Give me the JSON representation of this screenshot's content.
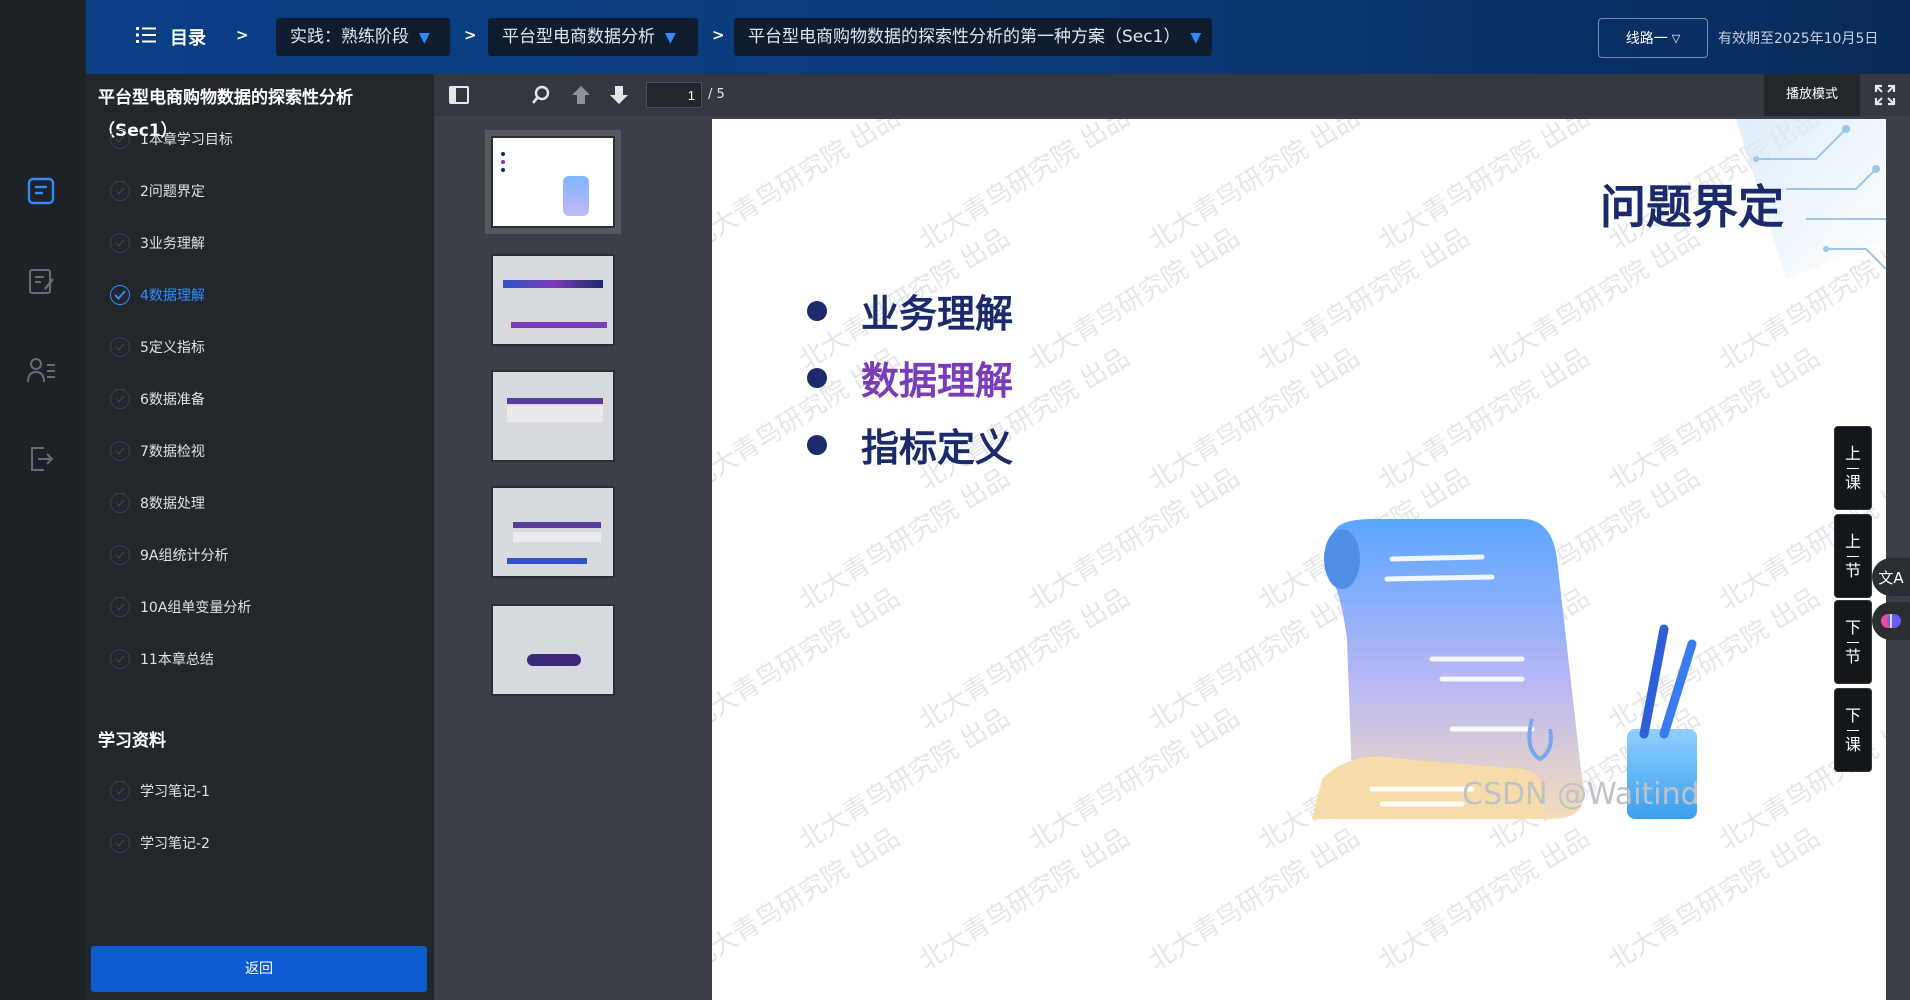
{
  "header": {
    "toc_label": "目录",
    "crumbs": [
      "实践：熟练阶段",
      "平台型电商数据分析",
      "平台型电商购物数据的探索性分析的第一种方案（Sec1）"
    ],
    "route_label": "线路一",
    "expiry": "有效期至2025年10月5日"
  },
  "panel": {
    "title": "平台型电商购物数据的探索性分析（Sec1）",
    "chapters": [
      {
        "label": "1本章学习目标",
        "active": false
      },
      {
        "label": "2问题界定",
        "active": false
      },
      {
        "label": "3业务理解",
        "active": false
      },
      {
        "label": "4数据理解",
        "active": true
      },
      {
        "label": "5定义指标",
        "active": false
      },
      {
        "label": "6数据准备",
        "active": false
      },
      {
        "label": "7数据检视",
        "active": false
      },
      {
        "label": "8数据处理",
        "active": false
      },
      {
        "label": "9A组统计分析",
        "active": false
      },
      {
        "label": "10A组单变量分析",
        "active": false
      },
      {
        "label": "11本章总结",
        "active": false
      }
    ],
    "resources_title": "学习资料",
    "resources": [
      "学习笔记-1",
      "学习笔记-2"
    ],
    "back_label": "返回"
  },
  "viewer": {
    "page_current": "1",
    "page_total": "/ 5",
    "play_mode": "播放模式"
  },
  "slide": {
    "title": "问题界定",
    "bullets": [
      {
        "text": "业务理解",
        "color": "#1b2a6b"
      },
      {
        "text": "数据理解",
        "color": "#7a3cb8"
      },
      {
        "text": "指标定义",
        "color": "#1b2a6b"
      }
    ],
    "watermark": "北大青鸟研究院 出品"
  },
  "nav": {
    "prev_lesson": [
      "上",
      "课"
    ],
    "prev_section": [
      "上",
      "节"
    ],
    "next_section": [
      "下",
      "节"
    ],
    "next_lesson": [
      "下",
      "课"
    ]
  },
  "footer_watermark": "CSDN @Waitind",
  "colors": {
    "accent": "#2f8cff",
    "topbar": "#0a3f86",
    "button": "#0d5bd0"
  }
}
